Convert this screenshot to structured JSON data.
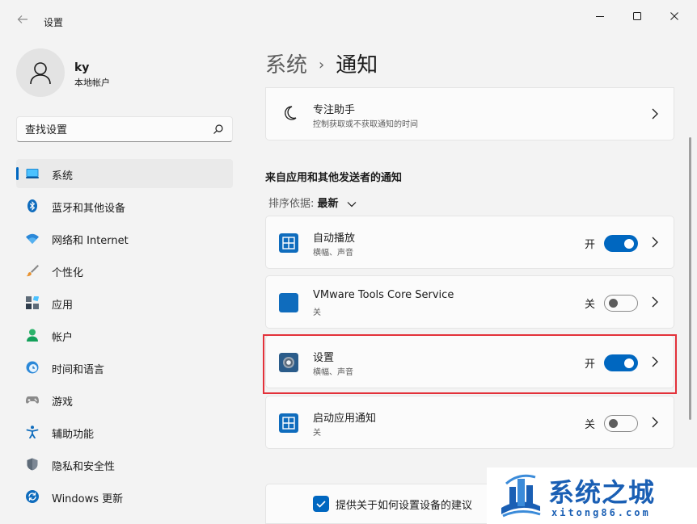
{
  "window": {
    "title": "设置",
    "back_icon": "back-arrow-icon",
    "controls": [
      "minimize-icon",
      "maximize-icon",
      "close-icon"
    ]
  },
  "profile": {
    "name": "ky",
    "account_type": "本地帐户"
  },
  "search": {
    "placeholder": "查找设置"
  },
  "sidebar": {
    "items": [
      {
        "label": "系统",
        "icon": "system-icon",
        "active": true
      },
      {
        "label": "蓝牙和其他设备",
        "icon": "bluetooth-icon"
      },
      {
        "label": "网络和 Internet",
        "icon": "network-icon"
      },
      {
        "label": "个性化",
        "icon": "brush-icon"
      },
      {
        "label": "应用",
        "icon": "apps-icon"
      },
      {
        "label": "帐户",
        "icon": "account-icon"
      },
      {
        "label": "时间和语言",
        "icon": "time-language-icon"
      },
      {
        "label": "游戏",
        "icon": "gaming-icon"
      },
      {
        "label": "辅助功能",
        "icon": "accessibility-icon"
      },
      {
        "label": "隐私和安全性",
        "icon": "shield-icon"
      },
      {
        "label": "Windows 更新",
        "icon": "windows-update-icon"
      }
    ]
  },
  "breadcrumb": {
    "parent": "系统",
    "separator": "›",
    "current": "通知"
  },
  "focus_assist": {
    "title": "专注助手",
    "subtitle": "控制获取或不获取通知的时间",
    "icon": "moon-icon"
  },
  "section": {
    "title": "来自应用和其他发送者的通知",
    "sort_label": "排序依据:",
    "sort_value": "最新"
  },
  "apps": [
    {
      "title": "自动播放",
      "subtitle": "横幅、声音",
      "state_label": "开",
      "on": true,
      "icon": "autoplay-icon"
    },
    {
      "title": "VMware Tools Core Service",
      "subtitle": "关",
      "state_label": "关",
      "on": false,
      "icon": "vmware-icon"
    },
    {
      "title": "设置",
      "subtitle": "横幅、声音",
      "state_label": "开",
      "on": true,
      "icon": "settings-gear-icon"
    },
    {
      "title": "启动应用通知",
      "subtitle": "关",
      "state_label": "关",
      "on": false,
      "icon": "startup-apps-icon"
    }
  ],
  "suggestion": {
    "label": "提供关于如何设置设备的建议",
    "checked": true
  },
  "watermark": {
    "brand": "系统之城",
    "url": "xitong86.com"
  },
  "colors": {
    "accent": "#0067c0",
    "highlight": "#e3313a",
    "watermark": "#1a5fb4"
  }
}
